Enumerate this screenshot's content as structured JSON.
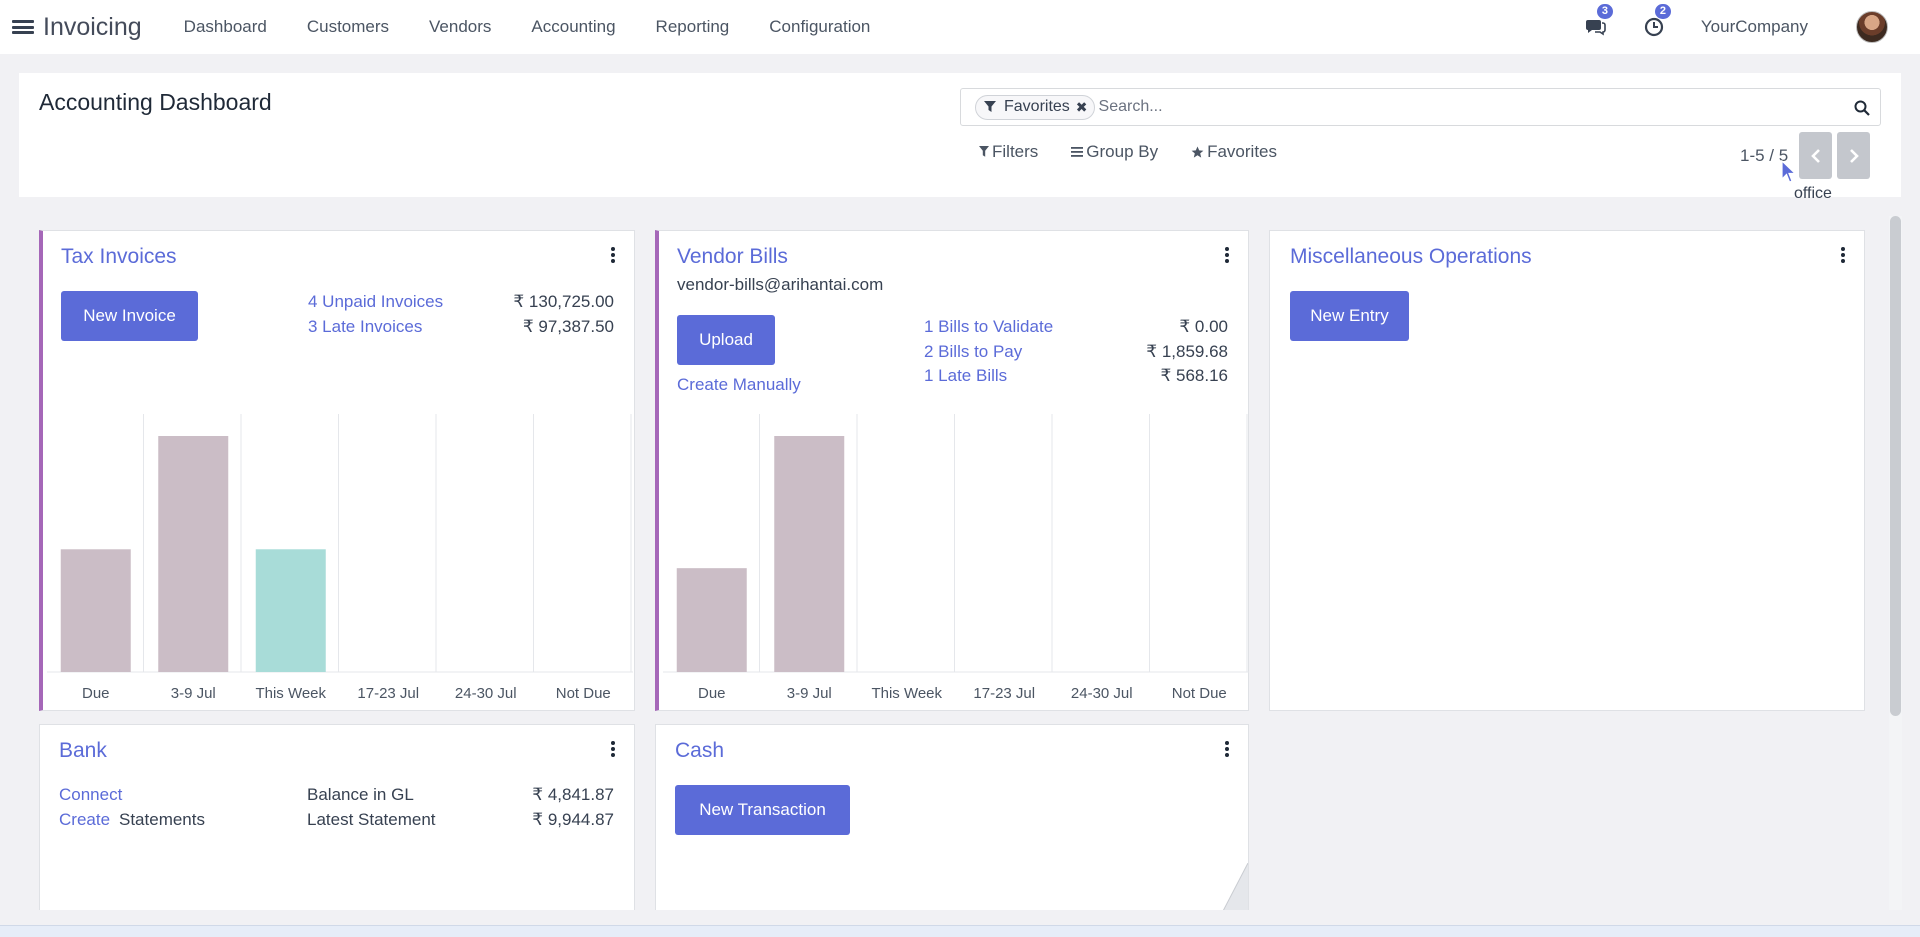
{
  "navbar": {
    "app_name": "Invoicing",
    "menu": [
      "Dashboard",
      "Customers",
      "Vendors",
      "Accounting",
      "Reporting",
      "Configuration"
    ],
    "messages_count": "3",
    "activities_count": "2",
    "company": "YourCompany"
  },
  "control_panel": {
    "title": "Accounting Dashboard",
    "facet_label": "Favorites",
    "search_placeholder": "Search...",
    "filters_label": "Filters",
    "group_by_label": "Group By",
    "favorites_label": "Favorites",
    "pager_value": "1-5 / 5",
    "tooltip": "office"
  },
  "colors": {
    "accent": "#5b6bd8",
    "card_border_accent": "#a567b8",
    "bar_past": "#cbbdc6",
    "bar_current": "#a8dcd8"
  },
  "cards": {
    "tax_invoices": {
      "title": "Tax Invoices",
      "button": "New Invoice",
      "unpaid_label": "4 Unpaid Invoices",
      "unpaid_value": "₹ 130,725.00",
      "late_label": "3 Late Invoices",
      "late_value": "₹ 97,387.50"
    },
    "vendor_bills": {
      "title": "Vendor Bills",
      "email": "vendor-bills@arihantai.com",
      "button": "Upload",
      "create_manually": "Create Manually",
      "validate_label": "1 Bills to Validate",
      "validate_value": "₹ 0.00",
      "pay_label": "2 Bills to Pay",
      "pay_value": "₹ 1,859.68",
      "late_label": "1 Late Bills",
      "late_value": "₹ 568.16"
    },
    "misc": {
      "title": "Miscellaneous Operations",
      "button": "New Entry"
    },
    "bank": {
      "title": "Bank",
      "connect": "Connect",
      "create": "Create",
      "statements": "Statements",
      "balance_label": "Balance in GL",
      "balance_value": "₹ 4,841.87",
      "latest_label": "Latest Statement",
      "latest_value": "₹ 9,944.87"
    },
    "cash": {
      "title": "Cash",
      "button": "New Transaction"
    }
  },
  "chart_data": [
    {
      "type": "bar",
      "categories": [
        "Due",
        "3-9 Jul",
        "This Week",
        "17-23 Jul",
        "24-30 Jul",
        "Not Due"
      ],
      "values": [
        52,
        100,
        52,
        0,
        0,
        0
      ],
      "current_index": 2,
      "grid": true
    },
    {
      "type": "bar",
      "categories": [
        "Due",
        "3-9 Jul",
        "This Week",
        "17-23 Jul",
        "24-30 Jul",
        "Not Due"
      ],
      "values": [
        44,
        100,
        0,
        0,
        0,
        0
      ],
      "current_index": 2,
      "grid": true
    }
  ]
}
